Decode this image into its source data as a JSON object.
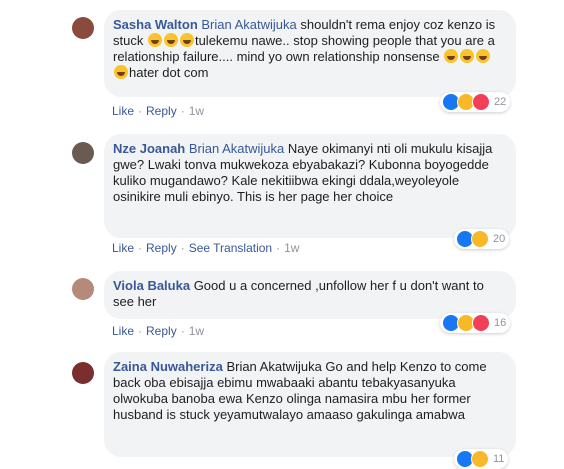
{
  "comments": [
    {
      "author": "Sasha Walton",
      "mention": "Brian Akatwijuka",
      "text_parts": [
        " shouldn't rema enjoy coz kenzo is stuck ",
        "tulekemu nawe.. stop showing people that you are a relationship failure.... mind yo own relationship nonsense ",
        "hater dot com"
      ],
      "actions": {
        "like": "Like",
        "reply": "Reply",
        "time": "1w"
      },
      "reactions": {
        "types": [
          "like-icon",
          "haha-icon",
          "love-icon"
        ],
        "count": "22"
      },
      "avatar_color": "#8a4b3c"
    },
    {
      "author": "Nze Joanah",
      "mention": "Brian Akatwijuka",
      "text": " Naye okimanyi nti oli mukulu kisajja gwe? Lwaki tonva mukwekoza ebyabakazi? Kubonna boyogedde kuliko mugandawo? Kale nekitiibwa ekingi ddala,weyoleyole osinikire muli ebinyo. This is her page her choice",
      "actions": {
        "like": "Like",
        "reply": "Reply",
        "translate": "See Translation",
        "time": "1w"
      },
      "reactions": {
        "types": [
          "like-icon",
          "haha-icon"
        ],
        "count": "20"
      },
      "avatar_color": "#6b5a52"
    },
    {
      "author": "Viola Baluka",
      "text": " Good u a concerned ,unfollow her f u don't want to see her",
      "actions": {
        "like": "Like",
        "reply": "Reply",
        "time": "1w"
      },
      "reactions": {
        "types": [
          "like-icon",
          "haha-icon",
          "love-icon"
        ],
        "count": "16"
      },
      "avatar_color": "#b58a7a"
    },
    {
      "author": "Zaina Nuwaheriza",
      "text": "Brian Akatwijuka Go and help Kenzo to come back oba ebisajja ebimu mwabaaki abantu tebakyasanyuka olwokuba banoba ewa Kenzo olinga namasira mbu her former husband is stuck yeyamutwalayo amaaso gakulinga amabwa",
      "reactions": {
        "types": [
          "like-icon",
          "haha-icon"
        ],
        "count": "11"
      },
      "avatar_color": "#7a2e2e"
    }
  ]
}
